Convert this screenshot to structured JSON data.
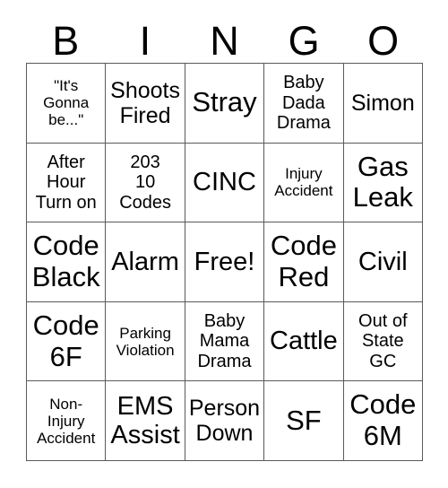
{
  "header": {
    "letters": [
      "B",
      "I",
      "N",
      "G",
      "O"
    ]
  },
  "grid": {
    "rows": 5,
    "columns": 5,
    "border_color": "#5a5a5a",
    "background_color": "#ffffff",
    "text_color": "#000000",
    "cells": [
      {
        "text": "\"It's\nGonna\nbe...\"",
        "size": "xs"
      },
      {
        "text": "Shoots\nFired",
        "size": "md"
      },
      {
        "text": "Stray",
        "size": "xl"
      },
      {
        "text": "Baby\nDada\nDrama",
        "size": "sm"
      },
      {
        "text": "Simon",
        "size": "md"
      },
      {
        "text": "After\nHour\nTurn on",
        "size": "sm"
      },
      {
        "text": "203\n10\nCodes",
        "size": "sm"
      },
      {
        "text": "CINC",
        "size": "lg"
      },
      {
        "text": "Injury\nAccident",
        "size": "xs"
      },
      {
        "text": "Gas\nLeak",
        "size": "xl"
      },
      {
        "text": "Code\nBlack",
        "size": "xl"
      },
      {
        "text": "Alarm",
        "size": "lg"
      },
      {
        "text": "Free!",
        "size": "lg"
      },
      {
        "text": "Code\nRed",
        "size": "xl"
      },
      {
        "text": "Civil",
        "size": "lg"
      },
      {
        "text": "Code\n6F",
        "size": "xl"
      },
      {
        "text": "Parking\nViolation",
        "size": "xs"
      },
      {
        "text": "Baby\nMama\nDrama",
        "size": "sm"
      },
      {
        "text": "Cattle",
        "size": "lg"
      },
      {
        "text": "Out of\nState\nGC",
        "size": "sm"
      },
      {
        "text": "Non-\nInjury\nAccident",
        "size": "xs"
      },
      {
        "text": "EMS\nAssist",
        "size": "lg"
      },
      {
        "text": "Person\nDown",
        "size": "md"
      },
      {
        "text": "SF",
        "size": "xl"
      },
      {
        "text": "Code\n6M",
        "size": "xl"
      }
    ]
  }
}
